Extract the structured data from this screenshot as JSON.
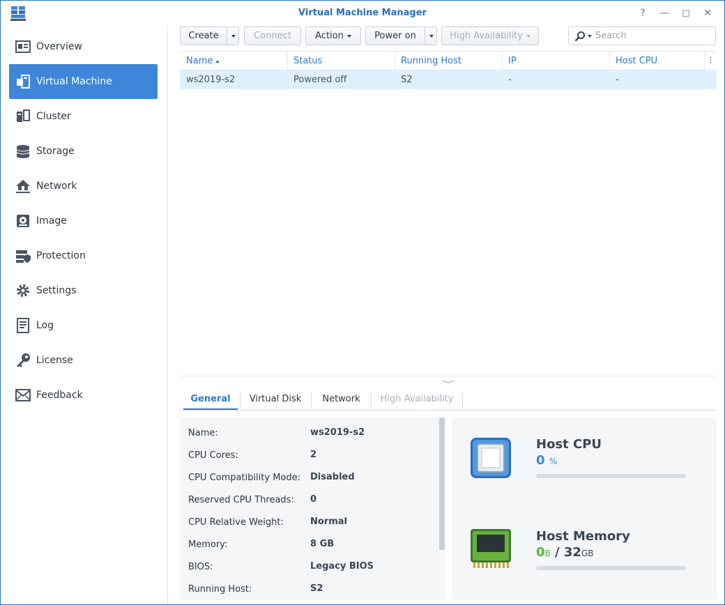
{
  "app": {
    "title": "Virtual Machine Manager"
  },
  "window_controls": {
    "help": "?",
    "minimize": "—",
    "maximize": "◻",
    "close": "✕"
  },
  "sidebar": {
    "items": [
      {
        "label": "Overview",
        "icon": "overview-icon"
      },
      {
        "label": "Virtual Machine",
        "icon": "virtual-machine-icon",
        "active": true
      },
      {
        "label": "Cluster",
        "icon": "cluster-icon"
      },
      {
        "label": "Storage",
        "icon": "storage-icon"
      },
      {
        "label": "Network",
        "icon": "network-icon"
      },
      {
        "label": "Image",
        "icon": "image-icon"
      },
      {
        "label": "Protection",
        "icon": "protection-icon"
      },
      {
        "label": "Settings",
        "icon": "gear-icon"
      },
      {
        "label": "Log",
        "icon": "log-icon"
      },
      {
        "label": "License",
        "icon": "key-icon"
      },
      {
        "label": "Feedback",
        "icon": "mail-icon"
      }
    ]
  },
  "toolbar": {
    "create": "Create",
    "connect": "Connect",
    "action": "Action",
    "power_on": "Power on",
    "high_availability": "High Availability",
    "search_placeholder": "Search"
  },
  "grid": {
    "columns": [
      "Name",
      "Status",
      "Running Host",
      "IP",
      "Host CPU"
    ],
    "rows": [
      {
        "name": "ws2019-s2",
        "status": "Powered off",
        "running_host": "S2",
        "ip": "-",
        "host_cpu": "-"
      }
    ]
  },
  "tabs": [
    "General",
    "Virtual Disk",
    "Network",
    "High Availability"
  ],
  "general": {
    "fields": [
      {
        "label": "Name:",
        "value": "ws2019-s2"
      },
      {
        "label": "CPU Cores:",
        "value": "2"
      },
      {
        "label": "CPU Compatibility Mode:",
        "value": "Disabled"
      },
      {
        "label": "Reserved CPU Threads:",
        "value": "0"
      },
      {
        "label": "CPU Relative Weight:",
        "value": "Normal"
      },
      {
        "label": "Memory:",
        "value": "8 GB"
      },
      {
        "label": "BIOS:",
        "value": "Legacy BIOS"
      },
      {
        "label": "Running Host:",
        "value": "S2"
      }
    ]
  },
  "host": {
    "cpu": {
      "title": "Host CPU",
      "value": "0",
      "unit": "%",
      "usage_fraction": 0,
      "color": "#3d86d9"
    },
    "memory": {
      "title": "Host Memory",
      "used": "0",
      "used_unit": "B",
      "separator": "/",
      "total": "32",
      "total_unit": "GB",
      "usage_fraction": 0,
      "used_color": "#5bb33e",
      "total_color": "#3b4653"
    }
  },
  "colors": {
    "accent": "#3d86d9",
    "header_text": "#2f78cb",
    "selected_row": "#dff0fd"
  }
}
